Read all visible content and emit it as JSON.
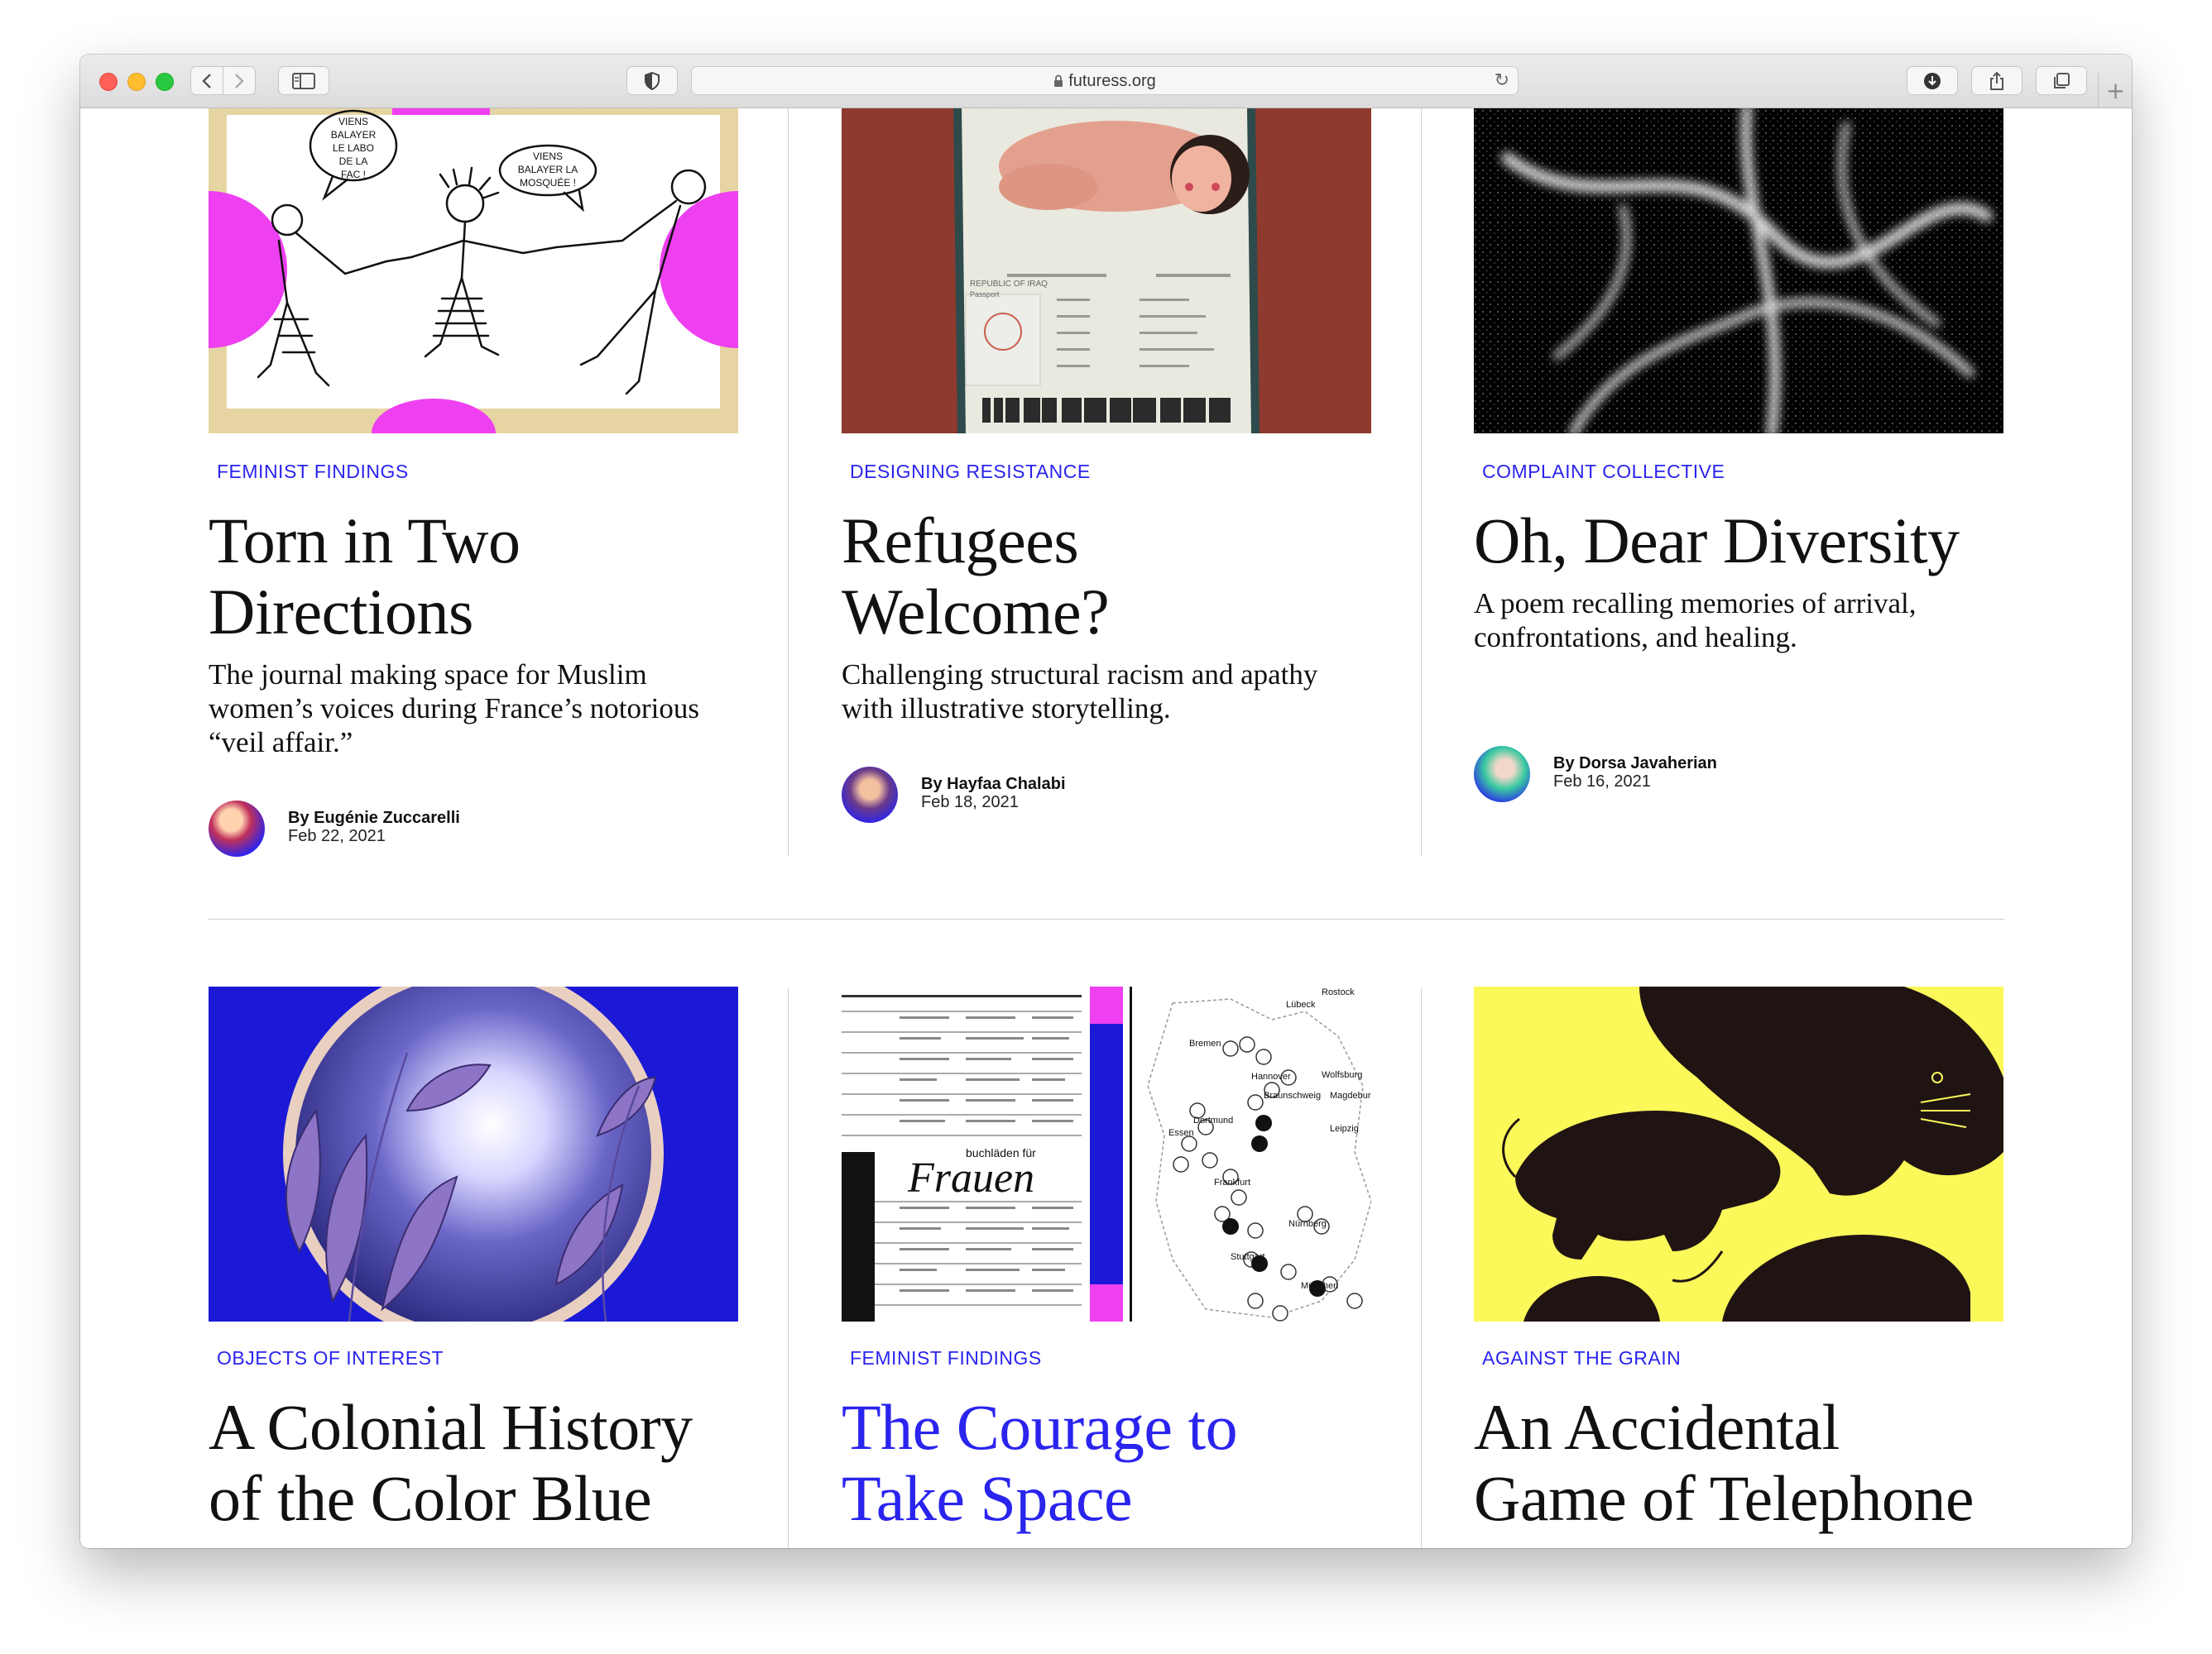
{
  "browser": {
    "url": "futuress.org",
    "back_icon": "chevron-left-icon",
    "forward_icon": "chevron-right-icon"
  },
  "colors": {
    "accent": "#2a24ee",
    "magenta": "#ee3ff0",
    "yellow": "#fbf85a"
  },
  "articles": [
    {
      "category": "FEMINIST FINDINGS",
      "title_line1": "Torn in Two",
      "title_line2": "Directions",
      "desc_line1": "The journal making space for Muslim",
      "desc_line2": "women’s voices during France’s notorious",
      "desc_line3": "“veil affair.”",
      "author": "By Eugénie Zuccarelli",
      "date": "Feb 22, 2021",
      "bubble1_line1": "VIENS",
      "bubble1_line2": "BALAYER",
      "bubble1_line3": "LE LABO",
      "bubble1_line4": "DE LA",
      "bubble1_line5": "FAC !",
      "bubble2_line1": "VIENS",
      "bubble2_line2": "BALAYER LA",
      "bubble2_line3": "MOSQUÉE !"
    },
    {
      "category": "DESIGNING RESISTANCE",
      "title_line1": "Refugees",
      "title_line2": "Welcome?",
      "desc_line1": "Challenging structural racism and apathy",
      "desc_line2": "with illustrative storytelling.",
      "author": "By Hayfaa Chalabi",
      "date": "Feb 18, 2021",
      "passport_line1": "REPUBLIC OF IRAQ",
      "passport_line2": "Passport"
    },
    {
      "category": "COMPLAINT COLLECTIVE",
      "title_line1": "Oh, Dear Diversity",
      "desc_line1": "A poem recalling memories of arrival,",
      "desc_line2": "confrontations, and healing.",
      "author": "By Dorsa Javaherian",
      "date": "Feb 16, 2021"
    },
    {
      "category": "OBJECTS OF INTEREST",
      "title_line1": "A Colonial History",
      "title_line2": "of the Color Blue"
    },
    {
      "category": "FEMINIST FINDINGS",
      "title_line1": "The Courage to",
      "title_line2": "Take Space",
      "scan_heading_small": "buchläden für",
      "scan_heading_large": "Frauen",
      "map_cities": [
        "Rostock",
        "Lübeck",
        "Bremen",
        "Hannover",
        "Wolfsburg",
        "Braunschweig",
        "Magdeburg",
        "Dortmund",
        "Essen",
        "Leipzig",
        "Frankfurt",
        "Nürnberg",
        "Stuttgart",
        "München"
      ]
    },
    {
      "category": "AGAINST THE GRAIN",
      "title_line1": "An Accidental",
      "title_line2": "Game of Telephone"
    }
  ]
}
